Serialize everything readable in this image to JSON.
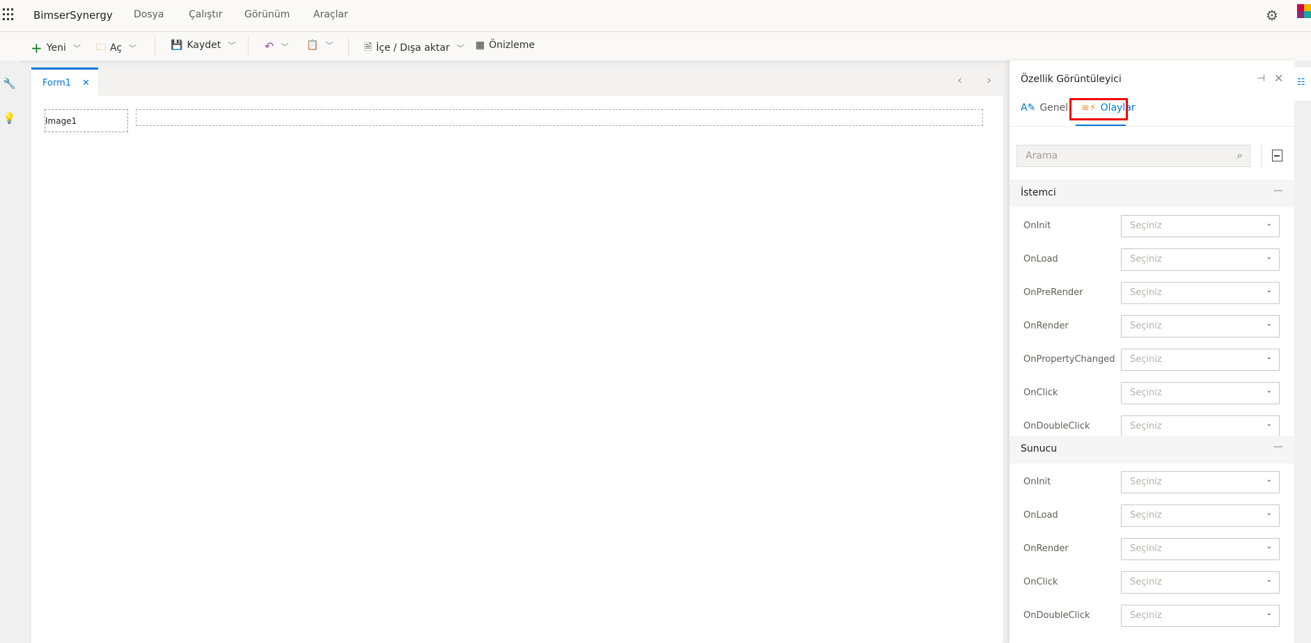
{
  "app": {
    "brand": "BimserSynergy",
    "menu": [
      "Dosya",
      "Çalıştır",
      "Görünüm",
      "Araçlar"
    ]
  },
  "toolbar": {
    "new": "Yeni",
    "open": "Aç",
    "save": "Kaydet",
    "import_export": "İçe / Dışa aktar",
    "preview": "Önizleme"
  },
  "tabs": [
    {
      "label": "Form1",
      "active": true
    }
  ],
  "canvas": {
    "image_label": "Image1"
  },
  "panel": {
    "title": "Özellik Görüntüleyici",
    "tabs": {
      "general": "Genel",
      "events": "Olaylar"
    },
    "search_placeholder": "Arama",
    "sections": [
      {
        "title": "İstemci",
        "rows": [
          {
            "label": "OnInit",
            "value": "Seçiniz"
          },
          {
            "label": "OnLoad",
            "value": "Seçiniz"
          },
          {
            "label": "OnPreRender",
            "value": "Seçiniz"
          },
          {
            "label": "OnRender",
            "value": "Seçiniz"
          },
          {
            "label": "OnPropertyChanged",
            "value": "Seçiniz"
          },
          {
            "label": "OnClick",
            "value": "Seçiniz"
          },
          {
            "label": "OnDoubleClick",
            "value": "Seçiniz"
          }
        ]
      },
      {
        "title": "Sunucu",
        "rows": [
          {
            "label": "OnInit",
            "value": "Seçiniz"
          },
          {
            "label": "OnLoad",
            "value": "Seçiniz"
          },
          {
            "label": "OnRender",
            "value": "Seçiniz"
          },
          {
            "label": "OnClick",
            "value": "Seçiniz"
          },
          {
            "label": "OnDoubleClick",
            "value": "Seçiniz"
          }
        ]
      }
    ]
  },
  "colors": {
    "accent": "#0078d4",
    "highlight": "#e00000"
  }
}
